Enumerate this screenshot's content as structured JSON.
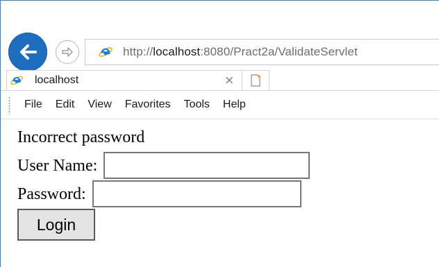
{
  "browser": {
    "address": {
      "prefix": "http://",
      "host": "localhost",
      "path": ":8080/Pract2a/ValidateServlet"
    },
    "tab": {
      "title": "localhost",
      "close_glyph": "×"
    },
    "menu": [
      "File",
      "Edit",
      "View",
      "Favorites",
      "Tools",
      "Help"
    ],
    "icons": {
      "back": "back-arrow-icon",
      "forward": "forward-arrow-icon",
      "site": "internet-explorer-icon",
      "new_tab": "new-tab-icon"
    },
    "colors": {
      "back_button": "#1f6dc0",
      "ie_logo": "#1e7fd6"
    }
  },
  "page": {
    "message": "Incorrect password",
    "username_label": "User Name:",
    "username_value": "",
    "password_label": "Password:",
    "password_value": "",
    "login_label": "Login"
  }
}
